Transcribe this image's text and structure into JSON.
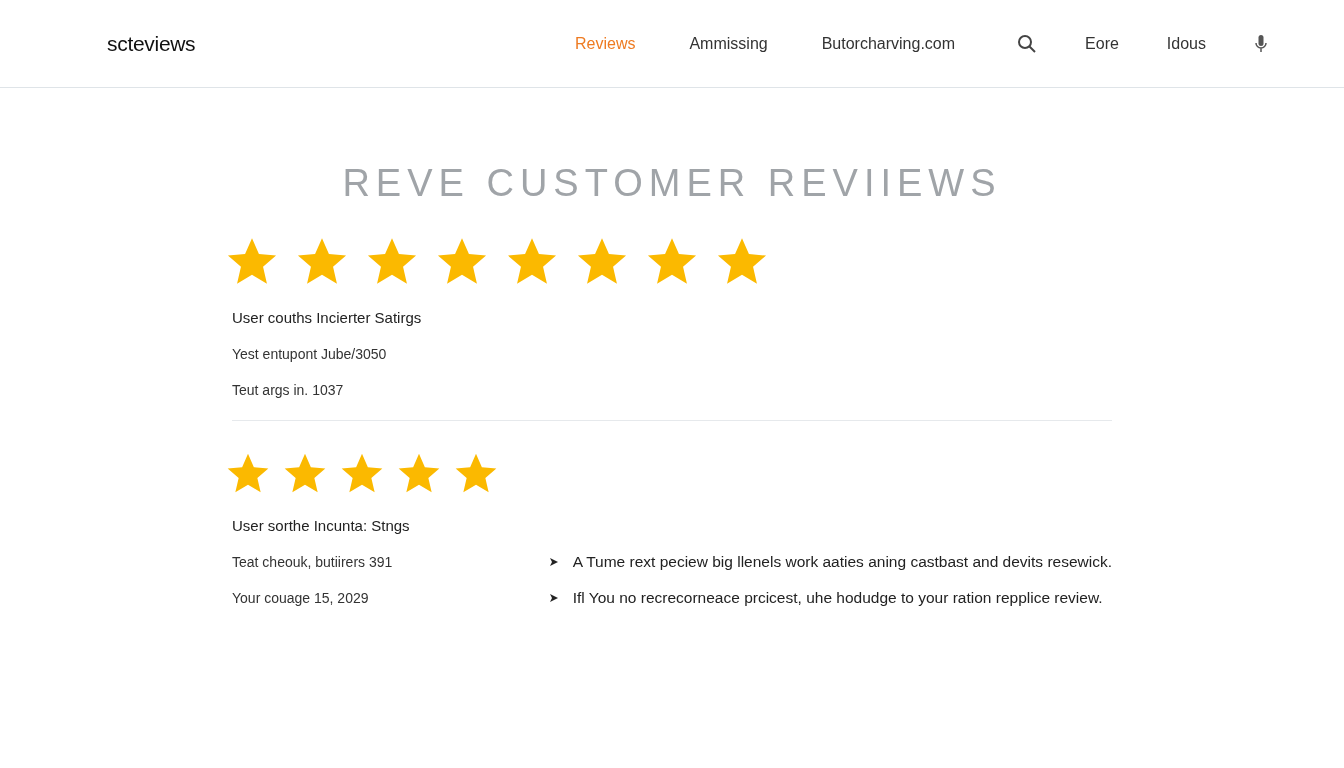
{
  "header": {
    "logo": "scteviews",
    "nav": [
      {
        "label": "Reviews",
        "selected": true
      },
      {
        "label": "Ammissing",
        "selected": false
      },
      {
        "label": "Butorcharving.com",
        "selected": false
      }
    ],
    "links": [
      "Eore",
      "Idous"
    ]
  },
  "title": "REVE CUSTOMER REVIIEWS",
  "reviews": [
    {
      "stars": 8,
      "heading": "User couths Incierter Satirgs",
      "lines": [
        "Yest entupont Jube/3050",
        "Teut args in. 1037"
      ]
    },
    {
      "stars": 5,
      "heading": "User sorthe Incunta: Stngs",
      "lines": [
        "Teat cheouk, butiirers 391",
        "Your couage 15, 2029"
      ],
      "bullets": [
        "A Tume rext peciew big llenels work aaties aning castbast and devits resewick.",
        "Ifl You no recrecorneace prcicest, uhe hodudge to your ration repplice review."
      ]
    }
  ]
}
